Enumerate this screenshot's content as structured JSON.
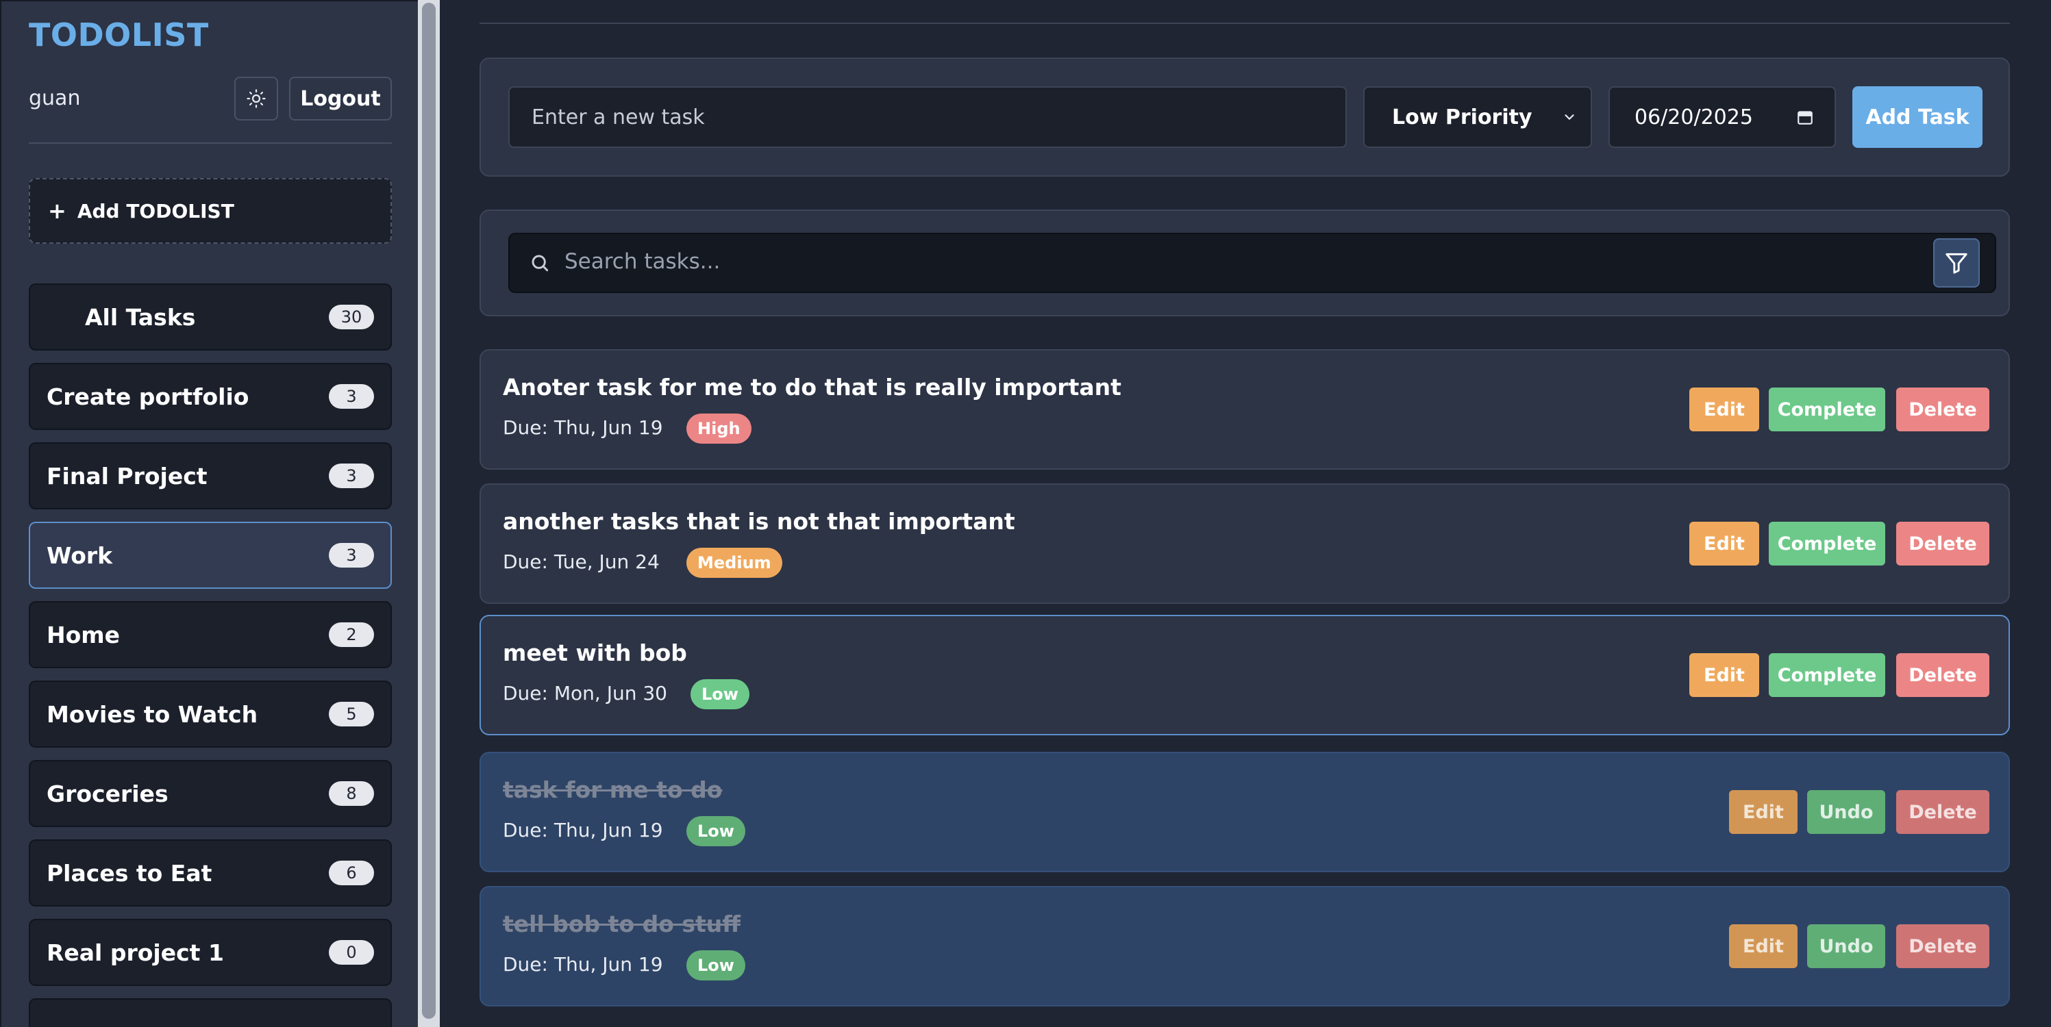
{
  "sidebar": {
    "brand": "TODOLIST",
    "username": "guan",
    "logout_label": "Logout",
    "add_list_label": "Add TODOLIST",
    "lists": [
      {
        "label": "All Tasks",
        "count": "30"
      },
      {
        "label": "Create portfolio",
        "count": "3"
      },
      {
        "label": "Final Project",
        "count": "3"
      },
      {
        "label": "Work",
        "count": "3"
      },
      {
        "label": "Home",
        "count": "2"
      },
      {
        "label": "Movies to Watch",
        "count": "5"
      },
      {
        "label": "Groceries",
        "count": "8"
      },
      {
        "label": "Places to Eat",
        "count": "6"
      },
      {
        "label": "Real project 1",
        "count": "0"
      }
    ],
    "active_list": "Work"
  },
  "new_task": {
    "placeholder": "Enter a new task",
    "priority_selected": "Low Priority",
    "date_value": "06/20/2025",
    "add_label": "Add Task"
  },
  "search": {
    "placeholder": "Search tasks..."
  },
  "tasks": [
    {
      "title": "Anoter task for me to do that is really important",
      "due": "Due: Thu, Jun 19",
      "priority": "High",
      "edit": "Edit",
      "action": "Complete",
      "delete": "Delete"
    },
    {
      "title": "another tasks that is not that important",
      "due": "Due: Tue, Jun 24",
      "priority": "Medium",
      "edit": "Edit",
      "action": "Complete",
      "delete": "Delete"
    },
    {
      "title": "meet with bob",
      "due": "Due: Mon, Jun 30",
      "priority": "Low",
      "edit": "Edit",
      "action": "Complete",
      "delete": "Delete"
    },
    {
      "title": "task for me to do",
      "due": "Due: Thu, Jun 19",
      "priority": "Low",
      "edit": "Edit",
      "action": "Undo",
      "delete": "Delete"
    },
    {
      "title": "tell bob to do stuff",
      "due": "Due: Thu, Jun 19",
      "priority": "Low",
      "edit": "Edit",
      "action": "Undo",
      "delete": "Delete"
    }
  ],
  "colors": {
    "accent": "#6aaee8",
    "high": "#ec8686",
    "medium": "#f0a95c",
    "low": "#6cc98a",
    "background": "#1f2533",
    "panel": "#2d3446"
  },
  "icons": [
    "sun-icon",
    "plus-icon",
    "search-icon",
    "filter-icon",
    "calendar-icon",
    "chevron-down-icon"
  ]
}
